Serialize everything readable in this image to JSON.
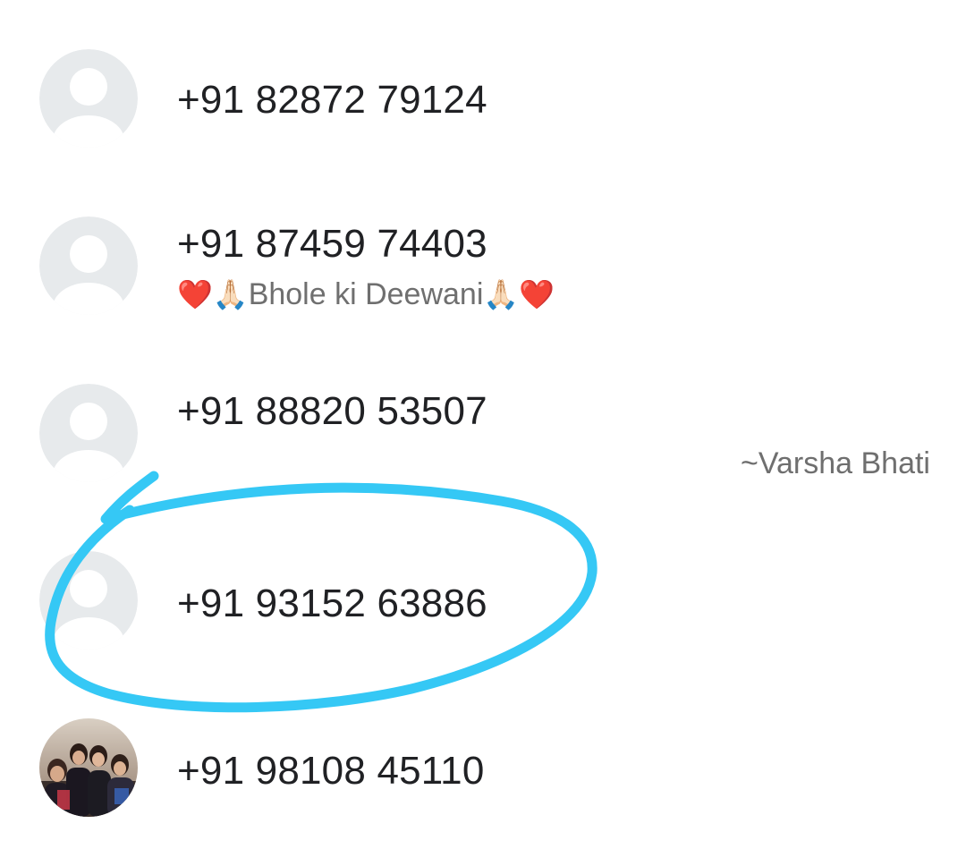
{
  "contacts": [
    {
      "phone": "+91 82872 79124",
      "avatar": "default-avatar"
    },
    {
      "phone": "+91 87459 74403",
      "avatar": "default-avatar",
      "about": {
        "emoji_left": "❤️🙏🏻",
        "text": "Bhole ki Deewani",
        "emoji_right": "🙏🏻❤️"
      }
    },
    {
      "phone": "+91 88820 53507",
      "avatar": "default-avatar",
      "push_name": "~Varsha Bhati"
    },
    {
      "phone": "+91 93152 63886",
      "avatar": "default-avatar",
      "highlighted": true
    },
    {
      "phone": "+91 98108 45110",
      "avatar": "group-photo"
    }
  ],
  "colors": {
    "avatar_bg": "#e7eaec",
    "avatar_fg": "#ffffff",
    "annotation": "#35c8f5",
    "text_primary": "#202124",
    "text_secondary": "#6f6f6f"
  }
}
